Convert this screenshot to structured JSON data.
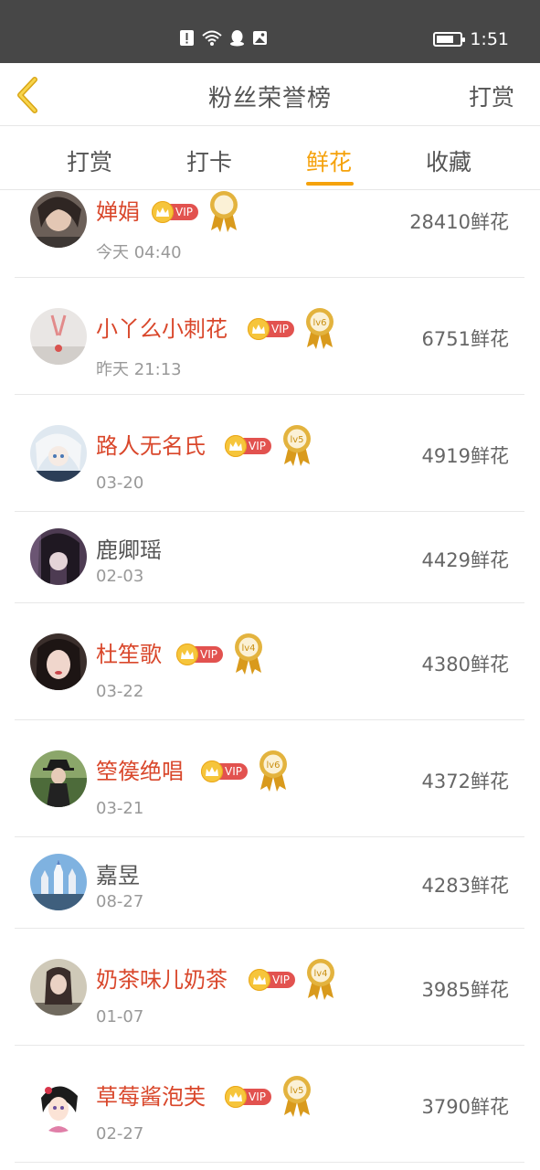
{
  "status_bar": {
    "time": "1:51",
    "battery_level": 0.75,
    "icons": [
      "alert-icon",
      "wifi-icon",
      "qq-icon",
      "image-icon"
    ]
  },
  "nav": {
    "title": "粉丝荣誉榜",
    "action": "打赏"
  },
  "tabs": [
    {
      "label": "打赏",
      "active": false
    },
    {
      "label": "打卡",
      "active": false
    },
    {
      "label": "鲜花",
      "active": true
    },
    {
      "label": "收藏",
      "active": false
    }
  ],
  "vip_label": "VIP",
  "colors": {
    "accent": "#f5a20c",
    "vip_name": "#d9472b",
    "vip_tag": "#e2524f",
    "medal_gold": "#e3b33e"
  },
  "rows": [
    {
      "name": "婵娟",
      "vip": true,
      "level": "",
      "date": "今天 04:40",
      "count": "28410鲜花",
      "avatar": "avatar-dark-hair"
    },
    {
      "name": "小丫么小刺花",
      "vip": true,
      "level": "lv6",
      "date": "昨天 21:13",
      "count": "6751鲜花",
      "avatar": "avatar-light"
    },
    {
      "name": "路人无名氏",
      "vip": true,
      "level": "lv5",
      "date": "03-20",
      "count": "4919鲜花",
      "avatar": "avatar-anime"
    },
    {
      "name": "鹿卿瑶",
      "vip": false,
      "level": "",
      "date": "02-03",
      "count": "4429鲜花",
      "avatar": "avatar-purple"
    },
    {
      "name": "杜笙歌",
      "vip": true,
      "level": "lv4",
      "date": "03-22",
      "count": "4380鲜花",
      "avatar": "avatar-girl"
    },
    {
      "name": "箜篌绝唱",
      "vip": true,
      "level": "lv6",
      "date": "03-21",
      "count": "4372鲜花",
      "avatar": "avatar-hat"
    },
    {
      "name": "嘉昱",
      "vip": false,
      "level": "",
      "date": "08-27",
      "count": "4283鲜花",
      "avatar": "avatar-castle"
    },
    {
      "name": "奶茶味儿奶茶",
      "vip": true,
      "level": "lv4",
      "date": "01-07",
      "count": "3985鲜花",
      "avatar": "avatar-photo"
    },
    {
      "name": "草莓酱泡芙",
      "vip": true,
      "level": "lv5",
      "date": "02-27",
      "count": "3790鲜花",
      "avatar": "avatar-cartoon"
    }
  ]
}
